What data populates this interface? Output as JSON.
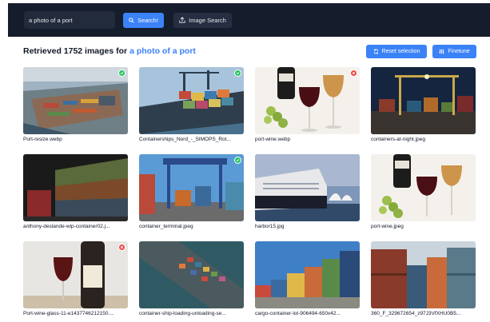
{
  "search": {
    "query": "a photo of a port",
    "search_label": "Search!",
    "image_search_label": "Image Search"
  },
  "results": {
    "prefix": "Retrieved 1752 images for ",
    "query": "a photo of a port",
    "reset_label": "Reset selection",
    "finetune_label": "Finetune"
  },
  "colors": {
    "accent": "#3b82f6",
    "topbar": "#151c2c",
    "selected": "#22c55e",
    "rejected": "#ef4444"
  },
  "images": [
    {
      "filename": "Port-resize.webp",
      "status": "selected"
    },
    {
      "filename": "Containerships_Nord_-_SIMOPS_Rot...",
      "status": "selected"
    },
    {
      "filename": "port-wine.webp",
      "status": "rejected"
    },
    {
      "filename": "containers-at-night.jpeg",
      "status": "none"
    },
    {
      "filename": "anthony-deslande-wip-container02.j...",
      "status": "none"
    },
    {
      "filename": "container_terminal.jpeg",
      "status": "selected"
    },
    {
      "filename": "harbor15.jpg",
      "status": "none"
    },
    {
      "filename": "port-wine.jpeg",
      "status": "none"
    },
    {
      "filename": "Port-wine-glass-11-e1437746212150....",
      "status": "rejected"
    },
    {
      "filename": "container-ship-loading-unloading-se...",
      "status": "none"
    },
    {
      "filename": "cargo-container-lot-906494-650x42...",
      "status": "none"
    },
    {
      "filename": "360_F_329672654_z97J3VfXHU0B5...",
      "status": "none"
    }
  ]
}
